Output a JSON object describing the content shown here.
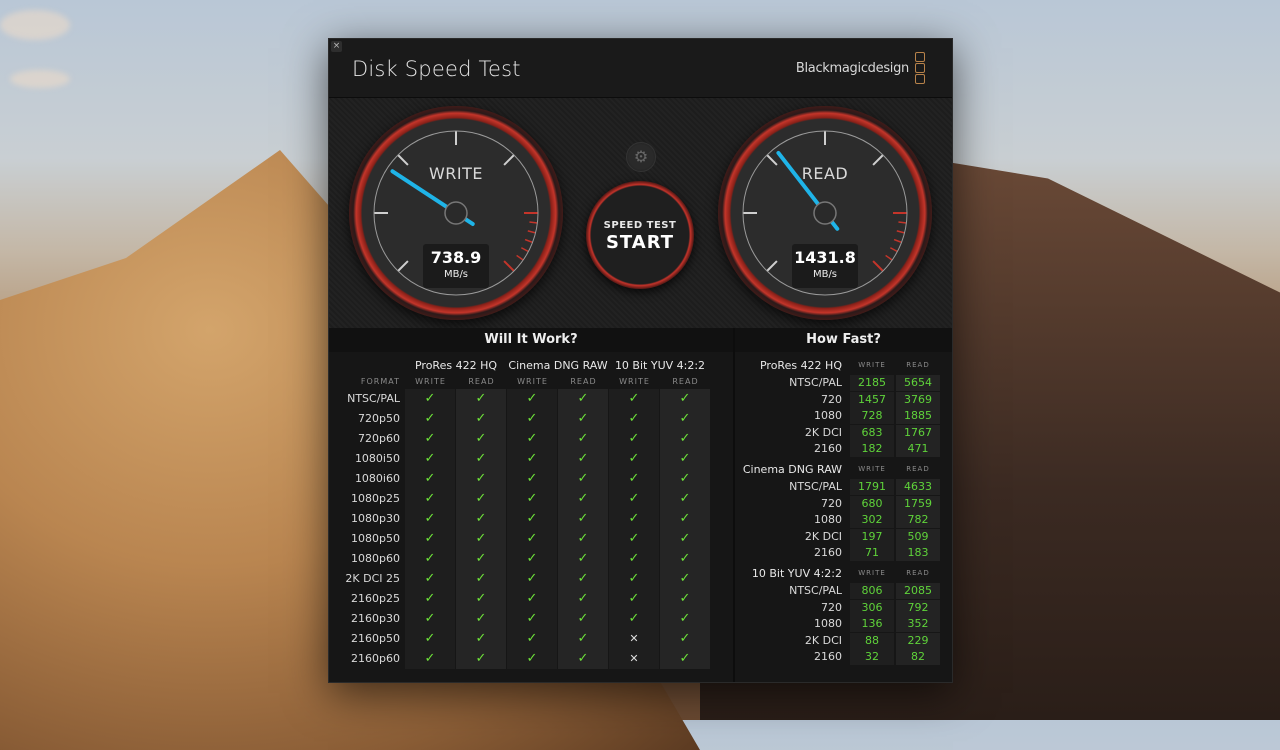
{
  "window": {
    "title": "Disk Speed Test",
    "brand": "Blackmagicdesign",
    "close_label": "×"
  },
  "gauges": {
    "write": {
      "label": "WRITE",
      "value": "738.9",
      "unit": "MB/s",
      "needle_fraction": 0.29
    },
    "read": {
      "label": "READ",
      "value": "1431.8",
      "unit": "MB/s",
      "needle_fraction": 0.36
    }
  },
  "controls": {
    "settings_icon": "⚙",
    "start_sub": "SPEED TEST",
    "start_main": "START"
  },
  "will_it_work": {
    "title": "Will It Work?",
    "format_header": "FORMAT",
    "codecs": [
      "ProRes 422 HQ",
      "Cinema DNG RAW",
      "10 Bit YUV 4:2:2"
    ],
    "col_headers": [
      "WRITE",
      "READ",
      "WRITE",
      "READ",
      "WRITE",
      "READ"
    ],
    "rows": [
      {
        "format": "NTSC/PAL",
        "results": [
          1,
          1,
          1,
          1,
          1,
          1
        ]
      },
      {
        "format": "720p50",
        "results": [
          1,
          1,
          1,
          1,
          1,
          1
        ]
      },
      {
        "format": "720p60",
        "results": [
          1,
          1,
          1,
          1,
          1,
          1
        ]
      },
      {
        "format": "1080i50",
        "results": [
          1,
          1,
          1,
          1,
          1,
          1
        ]
      },
      {
        "format": "1080i60",
        "results": [
          1,
          1,
          1,
          1,
          1,
          1
        ]
      },
      {
        "format": "1080p25",
        "results": [
          1,
          1,
          1,
          1,
          1,
          1
        ]
      },
      {
        "format": "1080p30",
        "results": [
          1,
          1,
          1,
          1,
          1,
          1
        ]
      },
      {
        "format": "1080p50",
        "results": [
          1,
          1,
          1,
          1,
          1,
          1
        ]
      },
      {
        "format": "1080p60",
        "results": [
          1,
          1,
          1,
          1,
          1,
          1
        ]
      },
      {
        "format": "2K DCI 25",
        "results": [
          1,
          1,
          1,
          1,
          1,
          1
        ]
      },
      {
        "format": "2160p25",
        "results": [
          1,
          1,
          1,
          1,
          1,
          1
        ]
      },
      {
        "format": "2160p30",
        "results": [
          1,
          1,
          1,
          1,
          1,
          1
        ]
      },
      {
        "format": "2160p50",
        "results": [
          1,
          1,
          1,
          1,
          0,
          1
        ]
      },
      {
        "format": "2160p60",
        "results": [
          1,
          1,
          1,
          1,
          0,
          1
        ]
      }
    ],
    "ok_symbol": "✓",
    "fail_symbol": "✕"
  },
  "how_fast": {
    "title": "How Fast?",
    "write_header": "WRITE",
    "read_header": "READ",
    "groups": [
      {
        "codec": "ProRes 422 HQ",
        "rows": [
          {
            "format": "NTSC/PAL",
            "write": "2185",
            "read": "5654"
          },
          {
            "format": "720",
            "write": "1457",
            "read": "3769"
          },
          {
            "format": "1080",
            "write": "728",
            "read": "1885"
          },
          {
            "format": "2K DCI",
            "write": "683",
            "read": "1767"
          },
          {
            "format": "2160",
            "write": "182",
            "read": "471"
          }
        ]
      },
      {
        "codec": "Cinema DNG RAW",
        "rows": [
          {
            "format": "NTSC/PAL",
            "write": "1791",
            "read": "4633"
          },
          {
            "format": "720",
            "write": "680",
            "read": "1759"
          },
          {
            "format": "1080",
            "write": "302",
            "read": "782"
          },
          {
            "format": "2K DCI",
            "write": "197",
            "read": "509"
          },
          {
            "format": "2160",
            "write": "71",
            "read": "183"
          }
        ]
      },
      {
        "codec": "10 Bit YUV 4:2:2",
        "rows": [
          {
            "format": "NTSC/PAL",
            "write": "806",
            "read": "2085"
          },
          {
            "format": "720",
            "write": "306",
            "read": "792"
          },
          {
            "format": "1080",
            "write": "136",
            "read": "352"
          },
          {
            "format": "2K DCI",
            "write": "88",
            "read": "229"
          },
          {
            "format": "2160",
            "write": "32",
            "read": "82"
          }
        ]
      }
    ]
  },
  "colors": {
    "accent_red": "#c4352a",
    "needle_blue": "#1fb4e8",
    "ok_green": "#6ee23a",
    "brand_orange": "#b7824a"
  }
}
